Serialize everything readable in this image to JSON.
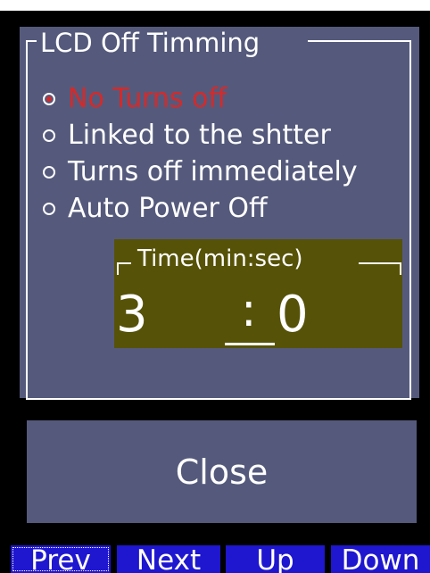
{
  "group": {
    "title": "LCD Off Timming"
  },
  "options": [
    {
      "label": "No Turns off",
      "selected": true
    },
    {
      "label": "Linked to the shtter",
      "selected": false
    },
    {
      "label": "Turns off immediately",
      "selected": false
    },
    {
      "label": "Auto Power Off",
      "selected": false
    }
  ],
  "time": {
    "title": "Time(min:sec)",
    "minutes": "3",
    "separator": ":",
    "seconds": "0"
  },
  "close_label": "Close",
  "nav": {
    "prev": "Prev",
    "next": "Next",
    "up": "Up",
    "down": "Down"
  },
  "colors": {
    "panel": "#555a7c",
    "selected_text": "#d42a2a",
    "time_box": "#565207",
    "nav_button": "#1f16cf"
  }
}
